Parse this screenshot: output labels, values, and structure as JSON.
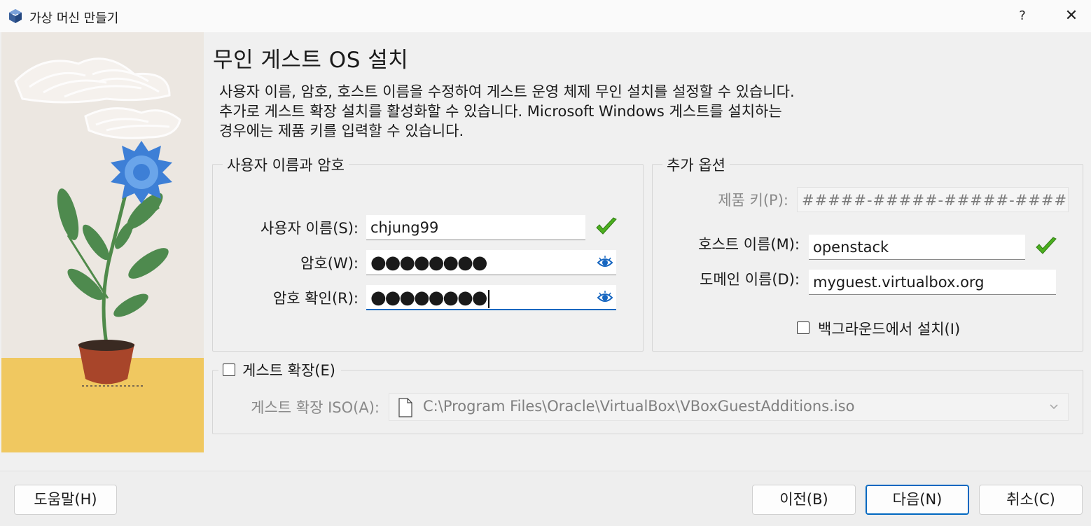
{
  "window": {
    "title": "가상 머신 만들기",
    "help_label": "?",
    "close_label": "✕"
  },
  "page": {
    "heading": "무인 게스트 OS 설치",
    "description_lines": [
      "사용자 이름, 암호, 호스트 이름을 수정하여 게스트 운영 체제 무인 설치를 설정할 수 있습니다.",
      "추가로 게스트 확장 설치를 활성화할 수 있습니다. Microsoft Windows 게스트를 설치하는",
      "경우에는 제품 키를 입력할 수 있습니다."
    ]
  },
  "credentials": {
    "group_title": "사용자 이름과 암호",
    "username_label": "사용자 이름(S):",
    "username_value": "chjung99",
    "password_label": "암호(W):",
    "password_value": "●●●●●●●●",
    "confirm_label": "암호 확인(R):",
    "confirm_value": "●●●●●●●●"
  },
  "extra_options": {
    "group_title": "추가 옵션",
    "product_key_label": "제품 키(P):",
    "product_key_value": "#####-#####-#####-#####",
    "hostname_label": "호스트 이름(M):",
    "hostname_value": "openstack",
    "domain_label": "도메인 이름(D):",
    "domain_value": "myguest.virtualbox.org",
    "background_install_label": "백그라운드에서 설치(I)",
    "background_install_checked": false
  },
  "guest_additions": {
    "checkbox_label": "게스트 확장(E)",
    "checked": false,
    "iso_label": "게스트 확장 ISO(A):",
    "iso_path": "C:\\Program Files\\Oracle\\VirtualBox\\VBoxGuestAdditions.iso"
  },
  "footer": {
    "help_button": "도움말(H)",
    "back_button": "이전(B)",
    "next_button": "다음(N)",
    "cancel_button": "취소(C)"
  },
  "colors": {
    "accent": "#0067c0",
    "valid_check": "#4caf1f",
    "eye_icon": "#1565c0"
  }
}
